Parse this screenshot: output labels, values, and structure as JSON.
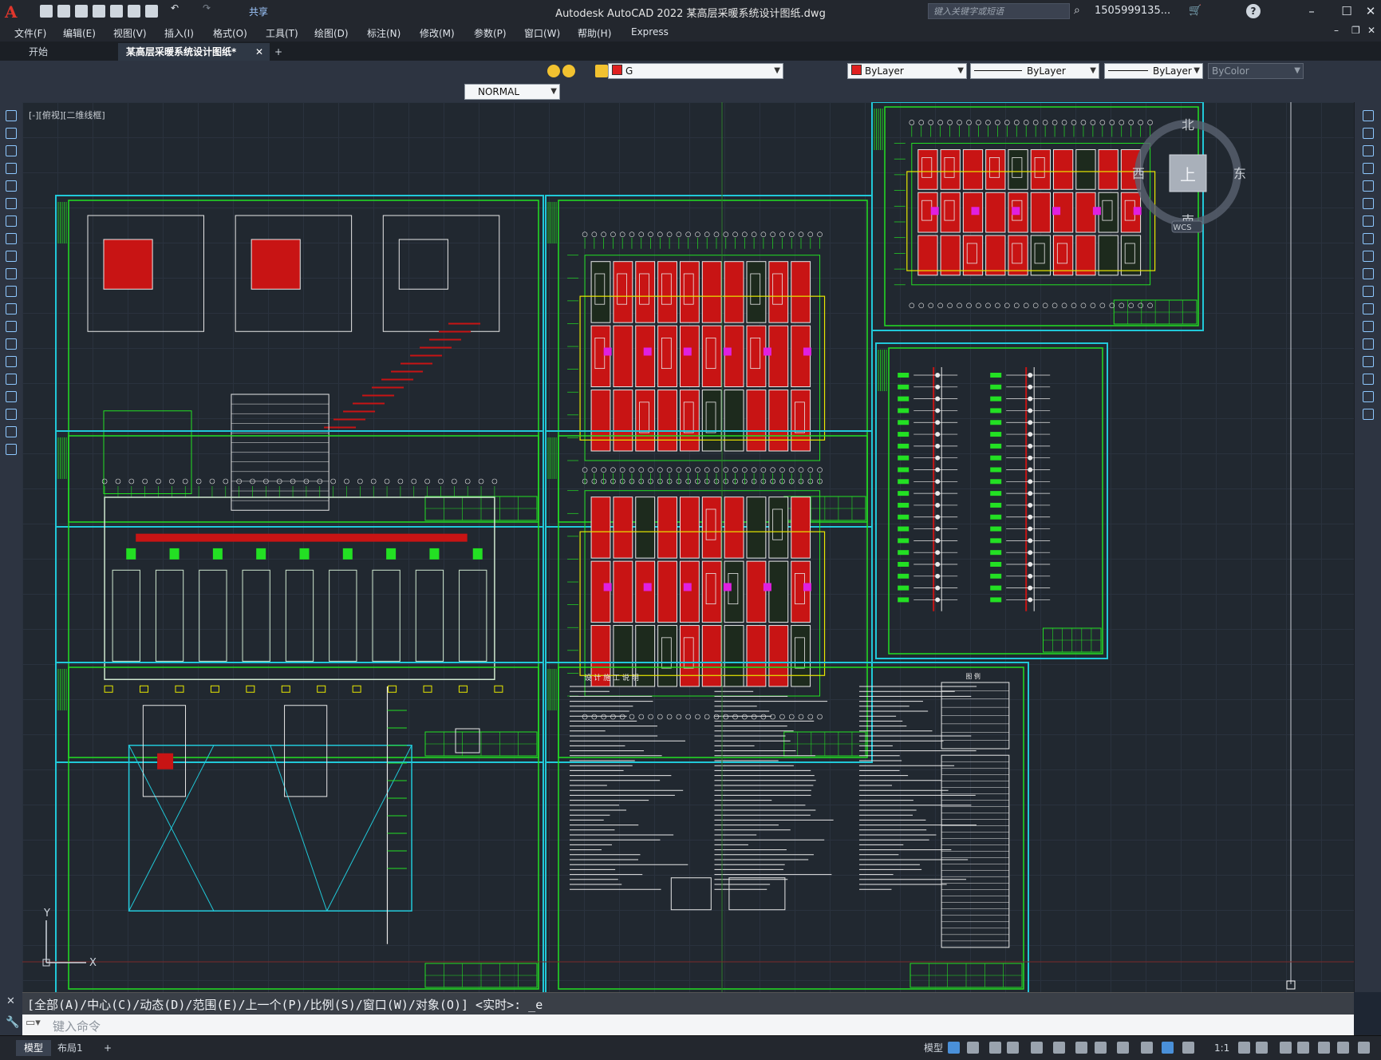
{
  "app": {
    "title": "Autodesk AutoCAD 2022    某高层采暖系统设计图纸.dwg",
    "logo": "A",
    "share_label": "共享",
    "search_placeholder": "键入关键字或短语",
    "user": "1505999135...",
    "help_icon": "?"
  },
  "menu": [
    "文件(F)",
    "编辑(E)",
    "视图(V)",
    "插入(I)",
    "格式(O)",
    "工具(T)",
    "绘图(D)",
    "标注(N)",
    "修改(M)",
    "参数(P)",
    "窗口(W)",
    "帮助(H)",
    "Express"
  ],
  "tabs": {
    "start": "开始",
    "doc": "某高层采暖系统设计图纸*",
    "add": "+"
  },
  "toolbar": {
    "layer_value": "G",
    "color_value": "ByLayer",
    "linetype_value": "ByLayer",
    "lineweight_value": "ByLayer",
    "plotstyle_value": "ByColor",
    "dimstyle_value": "NORMAL",
    "accent_red": "#e02020"
  },
  "viewport": {
    "label": "[-][俯视][二维线框]",
    "cube": {
      "north": "北",
      "south": "南",
      "east": "东",
      "west": "西",
      "top": "上",
      "wcs": "WCS"
    },
    "ucs": {
      "y": "Y",
      "x": "X"
    }
  },
  "command": {
    "history": "[全部(A)/中心(C)/动态(D)/范围(E)/上一个(P)/比例(S)/窗口(W)/对象(O)] <实时>: _e",
    "input_placeholder": "键入命令"
  },
  "status": {
    "tabs": [
      "模型",
      "布局1"
    ],
    "add": "+",
    "model_button": "模型",
    "scale": "1:1"
  },
  "drawing": {
    "sheet_titles": [
      "设 计 施 工 说 明",
      "图 例"
    ]
  }
}
